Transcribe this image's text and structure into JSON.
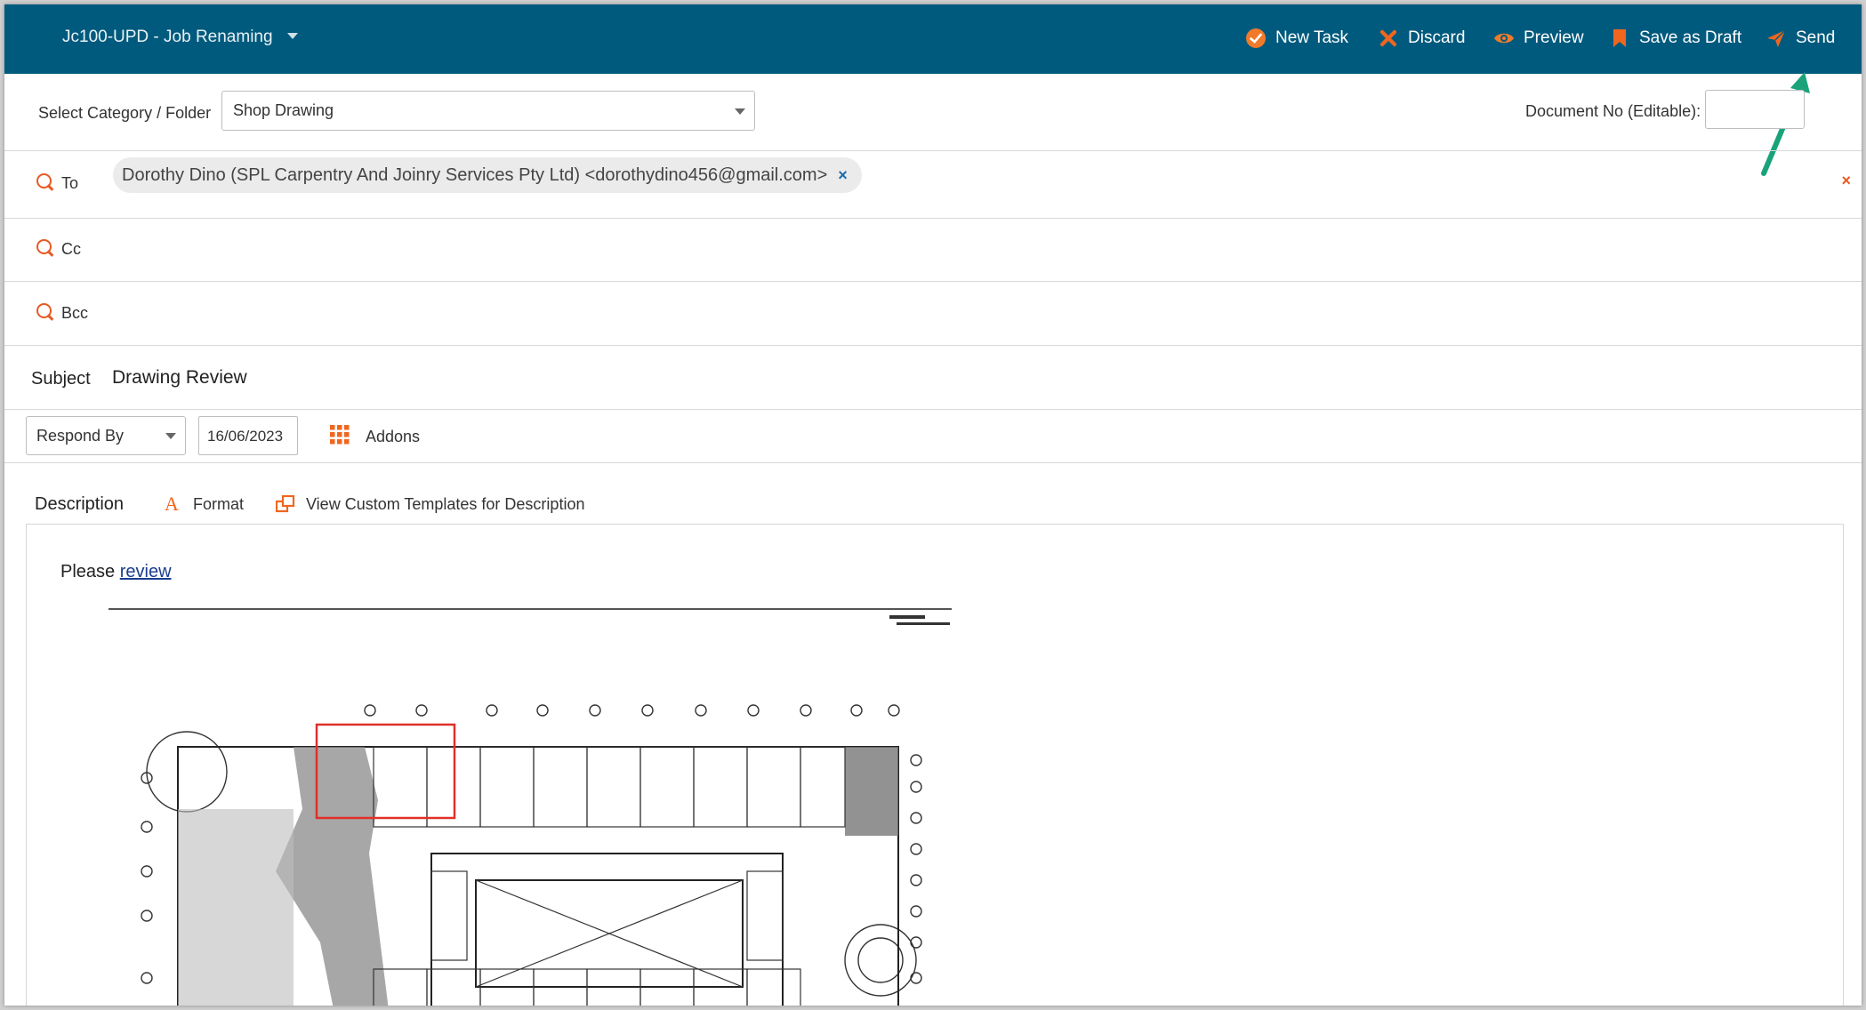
{
  "header": {
    "project_title": "Jc100-UPD - Job Renaming",
    "buttons": {
      "new_task": "New Task",
      "discard": "Discard",
      "preview": "Preview",
      "save_as_draft": "Save as Draft",
      "send": "Send"
    }
  },
  "category": {
    "label": "Select Category / Folder",
    "value": "Shop Drawing"
  },
  "document_no": {
    "label": "Document No (Editable):",
    "value": ""
  },
  "recipients": {
    "to_label": "To",
    "cc_label": "Cc",
    "bcc_label": "Bcc",
    "to_chip": "Dorothy Dino (SPL Carpentry And Joinry Services Pty Ltd) <dorothydino456@gmail.com>",
    "chip_remove": "×",
    "clear_all": "×"
  },
  "subject": {
    "label": "Subject",
    "value": "Drawing Review"
  },
  "respond": {
    "select_value": "Respond By",
    "date": "16/06/2023",
    "addons_label": "Addons"
  },
  "description": {
    "label": "Description",
    "format_label": "Format",
    "format_glyph": "A",
    "templates_label": "View Custom Templates for Description",
    "body_text": "Please",
    "body_link": "review"
  },
  "colors": {
    "topbar": "#005a7d",
    "accent": "#e85a22",
    "arrow": "#1aa37a"
  }
}
